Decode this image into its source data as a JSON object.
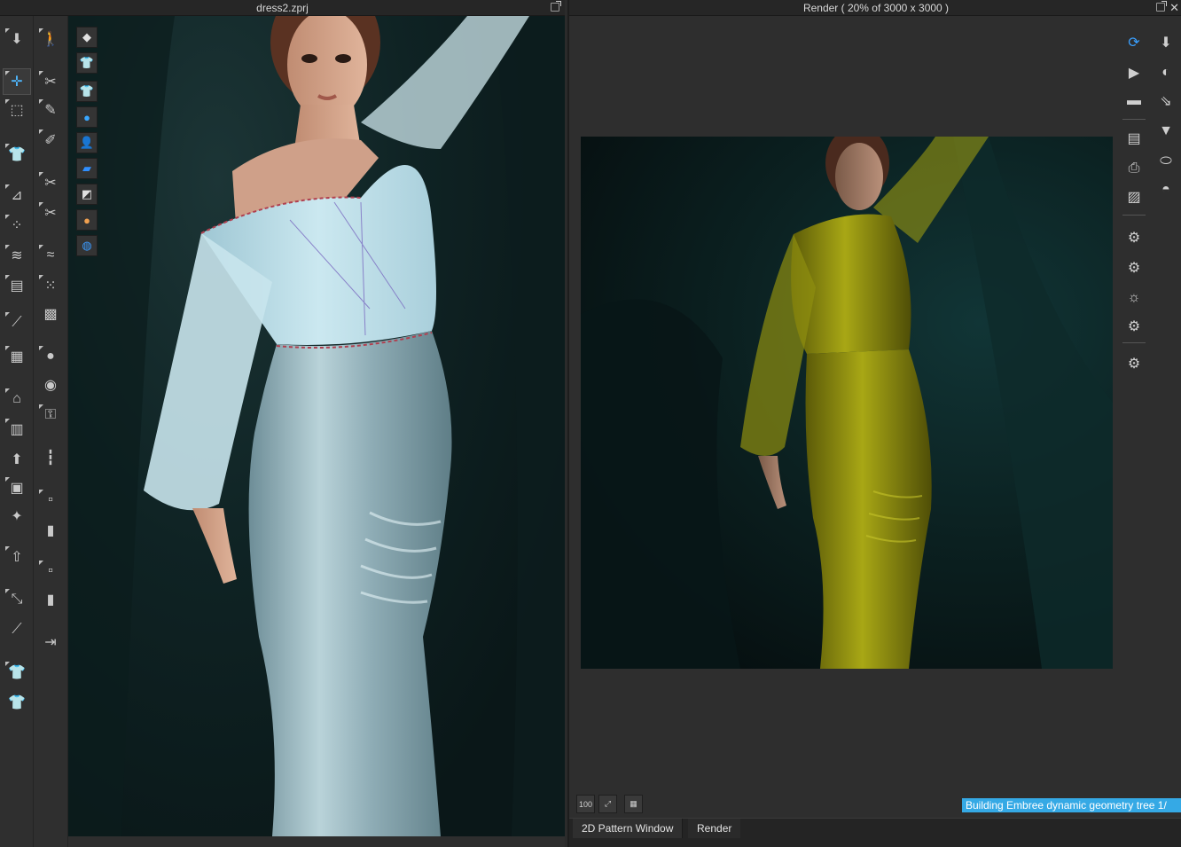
{
  "left_window": {
    "title": "dress2.zprj"
  },
  "render_window": {
    "title": "Render ( 20% of 3000 x 3000 )"
  },
  "bottom_buttons": {
    "zoom_100_label": "100"
  },
  "status": {
    "message": "Building Embree dynamic geometry tree 1/"
  },
  "tabs": [
    {
      "label": "2D Pattern Window"
    },
    {
      "label": "Render"
    }
  ],
  "colors": {
    "viewport_bg": "#0f2324",
    "render_bg": "#0b2020",
    "status_bg": "#35a9e5",
    "dress_sim": "#b9dde6",
    "dress_render": "#8a8a10"
  }
}
